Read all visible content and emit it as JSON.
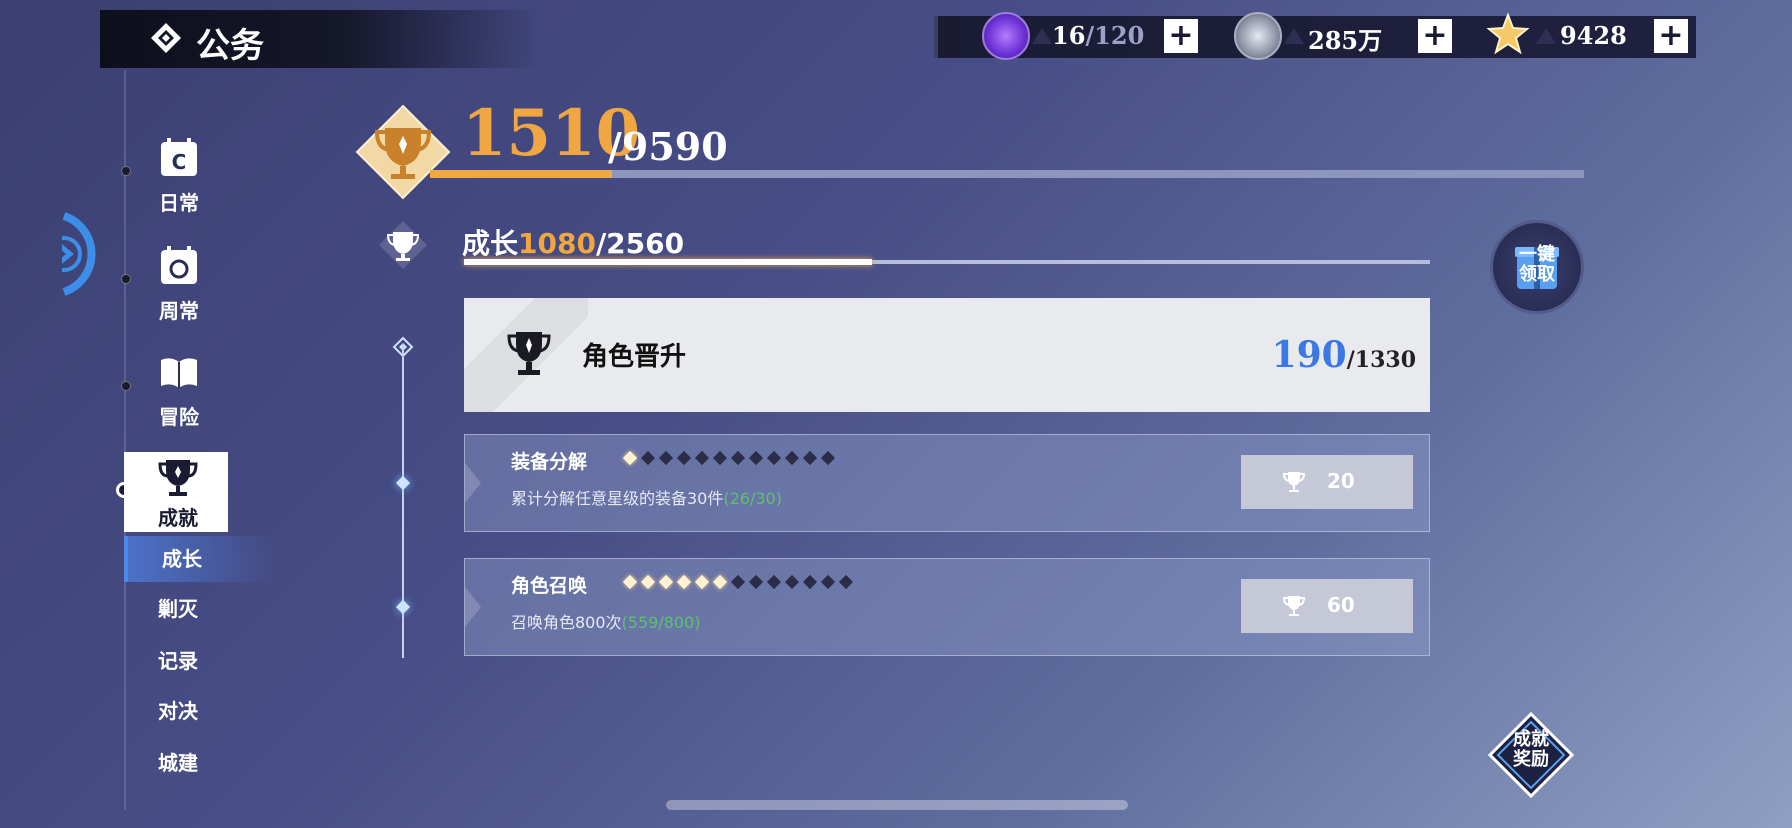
{
  "header": {
    "title": "公务"
  },
  "currencies": [
    {
      "icon": "stamina-icon",
      "value": "16",
      "max": "/120"
    },
    {
      "icon": "coin-icon",
      "value": "285万",
      "max": ""
    },
    {
      "icon": "star-gem-icon",
      "value": "9428",
      "max": ""
    }
  ],
  "plus_label": "+",
  "nav": {
    "items": [
      {
        "id": "daily",
        "label": "日常",
        "icon": "calendar-daily-icon"
      },
      {
        "id": "weekly",
        "label": "周常",
        "icon": "calendar-weekly-icon"
      },
      {
        "id": "adventure",
        "label": "冒险",
        "icon": "book-icon"
      },
      {
        "id": "achievement",
        "label": "成就",
        "icon": "trophy-icon"
      }
    ],
    "sub_items": [
      {
        "id": "growth",
        "label": "成长",
        "active": true
      },
      {
        "id": "annihilate",
        "label": "剿灭",
        "active": false
      },
      {
        "id": "record",
        "label": "记录",
        "active": false
      },
      {
        "id": "duel",
        "label": "对决",
        "active": false
      },
      {
        "id": "city",
        "label": "城建",
        "active": false
      }
    ]
  },
  "total": {
    "current": "1510",
    "max": "/9590",
    "fraction": 0.1575
  },
  "growth": {
    "label": "成长",
    "current": "1080",
    "max": "/2560",
    "fraction": 0.4219
  },
  "claim_all": {
    "line1": "一键",
    "line2": "领取"
  },
  "category": {
    "name": "角色晋升",
    "current": "190",
    "max": "/1330"
  },
  "tasks": [
    {
      "title": "装备分解",
      "desc": "累计分解任意星级的装备30件",
      "progress": "(26/30)",
      "stars_on": 1,
      "stars_total": 12,
      "reward": "20"
    },
    {
      "title": "角色召唤",
      "desc": "召唤角色800次",
      "progress": "(559/800)",
      "stars_on": 6,
      "stars_total": 13,
      "reward": "60"
    }
  ],
  "achievement_reward": {
    "line1": "成就",
    "line2": "奖励"
  },
  "colors": {
    "accent": "#f0a742",
    "blue": "#3b78e4",
    "green": "#5cc26e"
  }
}
